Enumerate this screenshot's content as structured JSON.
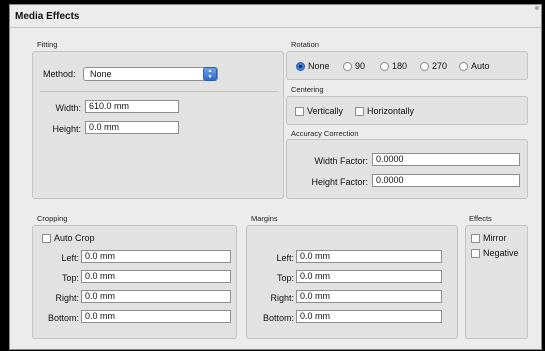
{
  "window": {
    "title": "Media Effects"
  },
  "fitting": {
    "label": "Fitting",
    "method_label": "Method:",
    "method_value": "None",
    "width_label": "Width:",
    "width_value": "610.0 mm",
    "height_label": "Height:",
    "height_value": "0.0 mm"
  },
  "rotation": {
    "label": "Rotation",
    "options": [
      "None",
      "90",
      "180",
      "270",
      "Auto"
    ],
    "selected": "None"
  },
  "centering": {
    "label": "Centering",
    "vertically": "Vertically",
    "horizontally": "Horizontally"
  },
  "accuracy": {
    "label": "Accuracy Correction",
    "width_factor_label": "Width Factor:",
    "width_factor_value": "0.0000",
    "height_factor_label": "Height Factor:",
    "height_factor_value": "0.0000"
  },
  "cropping": {
    "label": "Cropping",
    "auto_crop": "Auto Crop",
    "left_label": "Left:",
    "left_value": "0.0 mm",
    "top_label": "Top:",
    "top_value": "0.0 mm",
    "right_label": "Right:",
    "right_value": "0.0 mm",
    "bottom_label": "Bottom:",
    "bottom_value": "0.0 mm"
  },
  "margins": {
    "label": "Margins",
    "left_label": "Left:",
    "left_value": "0.0 mm",
    "top_label": "Top:",
    "top_value": "0.0 mm",
    "right_label": "Right:",
    "right_value": "0.0 mm",
    "bottom_label": "Bottom:",
    "bottom_value": "0.0 mm"
  },
  "effects": {
    "label": "Effects",
    "mirror": "Mirror",
    "negative": "Negative"
  }
}
